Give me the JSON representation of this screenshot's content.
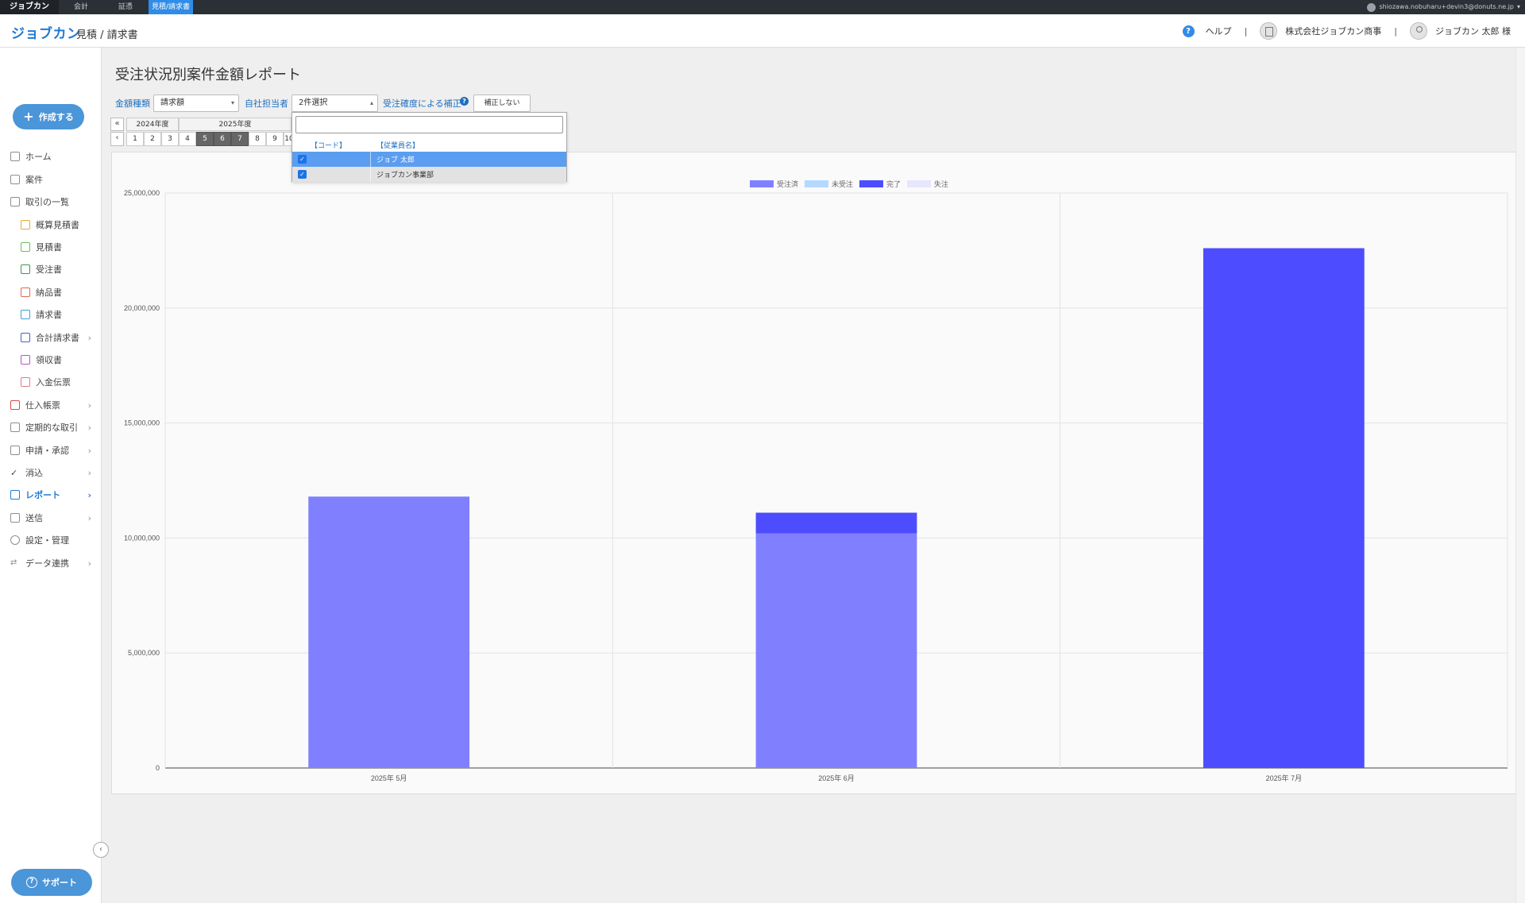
{
  "topbar": {
    "brand": "ジョブカン",
    "tabs": [
      "会計",
      "証憑",
      "見積/請求書"
    ],
    "account": "shiozawa.nobuharu+devin3@donuts.ne.jp"
  },
  "header": {
    "logo": "ジョブカン",
    "logo_sub": "見積 / 請求書",
    "help": "ヘルプ",
    "company": "株式会社ジョブカン商事",
    "user": "ジョブカン 太郎 様"
  },
  "sidebar": {
    "create": "作成する",
    "items": [
      {
        "label": "ホーム",
        "icon": "home-icon"
      },
      {
        "label": "案件",
        "icon": "flag-icon"
      },
      {
        "label": "取引の一覧",
        "icon": "list-icon"
      },
      {
        "label": "概算見積書",
        "icon": "doc-icon"
      },
      {
        "label": "見積書",
        "icon": "doc-icon"
      },
      {
        "label": "受注書",
        "icon": "doc-icon"
      },
      {
        "label": "納品書",
        "icon": "doc-icon"
      },
      {
        "label": "請求書",
        "icon": "doc-icon"
      },
      {
        "label": "合計請求書",
        "icon": "doc-icon"
      },
      {
        "label": "領収書",
        "icon": "doc-icon"
      },
      {
        "label": "入金伝票",
        "icon": "doc-icon"
      },
      {
        "label": "仕入帳票",
        "icon": "file-icon"
      },
      {
        "label": "定期的な取引",
        "icon": "calendar-icon"
      },
      {
        "label": "申請・承認",
        "icon": "clipboard-icon"
      },
      {
        "label": "消込",
        "icon": "check-icon"
      },
      {
        "label": "レポート",
        "icon": "report-icon"
      },
      {
        "label": "送信",
        "icon": "mail-icon"
      },
      {
        "label": "設定・管理",
        "icon": "gear-icon"
      },
      {
        "label": "データ連携",
        "icon": "sync-icon"
      }
    ],
    "support": "サポート"
  },
  "page": {
    "title": "受注状況別案件金額レポート",
    "filters": {
      "amount_type_label": "金額種類",
      "amount_type_value": "請求額",
      "owner_label": "自社担当者",
      "owner_value": "2件選択",
      "correction_label": "受注確度による補正",
      "correction_value": "補正しない"
    },
    "period": {
      "years": [
        "2024年度",
        "2025年度"
      ],
      "months": [
        "1",
        "2",
        "3",
        "4",
        "5",
        "6",
        "7",
        "8",
        "9",
        "10"
      ],
      "selected_months": [
        "5",
        "6",
        "7"
      ]
    },
    "dropdown": {
      "search_value": "",
      "col_code": "【コード】",
      "col_name": "【従業員名】",
      "rows": [
        {
          "name": "ジョブ 太郎",
          "checked": true
        },
        {
          "name": "ジョブカン事業部",
          "checked": true
        }
      ]
    }
  },
  "colors": {
    "accent": "#1e7ad6",
    "juchuzumi": "#8080ff",
    "mijuchu": "#b3d9ff",
    "kanryo": "#4d4dff",
    "shitchu": "#e6e6ff"
  },
  "chart_data": {
    "type": "bar",
    "stacked": true,
    "categories": [
      "2025年 5月",
      "2025年 6月",
      "2025年 7月"
    ],
    "series": [
      {
        "name": "受注済",
        "color": "#8080ff",
        "values": [
          11800000,
          10200000,
          0
        ]
      },
      {
        "name": "未受注",
        "color": "#b3d9ff",
        "values": [
          0,
          0,
          0
        ]
      },
      {
        "name": "完了",
        "color": "#4d4dff",
        "values": [
          0,
          900000,
          22600000
        ]
      },
      {
        "name": "失注",
        "color": "#e6e6ff",
        "values": [
          0,
          0,
          0
        ]
      }
    ],
    "yticks": [
      "25,000,000",
      "20,000,000",
      "15,000,000",
      "10,000,000",
      "5,000,000",
      "0"
    ],
    "ylim": [
      0,
      25000000
    ],
    "grid": true,
    "legend_position": "top-center"
  }
}
